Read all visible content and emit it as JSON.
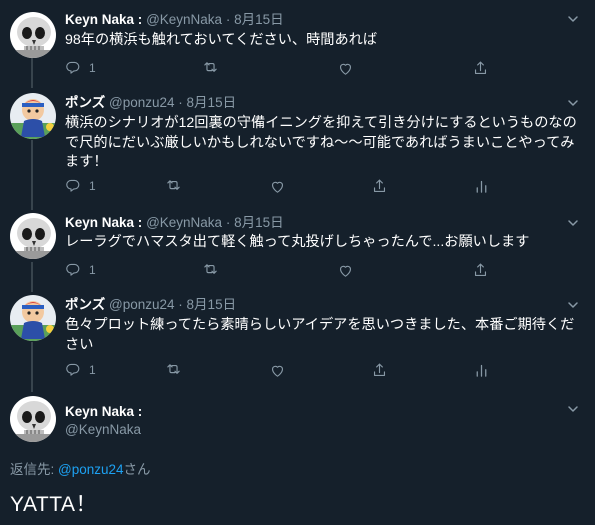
{
  "tweets": [
    {
      "name": "Keyn Naka :",
      "handle": "@KeynNaka",
      "date": "8月15日",
      "text": "98年の横浜も触れておいてください、時間あれば",
      "reply_count": "1",
      "avatar": "skull"
    },
    {
      "name": "ポンズ",
      "handle": "@ponzu24",
      "date": "8月15日",
      "text": "横浜のシナリオが12回裏の守備イニングを抑えて引き分けにするというものなので尺的にだいぶ厳しいかもしれないですね〜〜可能であればうまいことやってみます！",
      "reply_count": "1",
      "avatar": "character"
    },
    {
      "name": "Keyn Naka :",
      "handle": "@KeynNaka",
      "date": "8月15日",
      "text": "レーラグでハマスタ出て軽く触って丸投げしちゃったんで...お願いします",
      "reply_count": "1",
      "avatar": "skull"
    },
    {
      "name": "ポンズ",
      "handle": "@ponzu24",
      "date": "8月15日",
      "text": "色々プロット練ってたら素晴らしいアイデアを思いつきました、本番ご期待ください",
      "reply_count": "1",
      "avatar": "character"
    }
  ],
  "focused": {
    "name": "Keyn Naka :",
    "handle": "@KeynNaka",
    "reply_to_prefix": "返信先: ",
    "reply_to_handle": "@ponzu24",
    "reply_to_suffix": "さん",
    "text": "YATTA！"
  },
  "icons": [
    "reply-icon",
    "retweet-icon",
    "like-icon",
    "share-icon",
    "analytics-icon",
    "chevron-down-icon"
  ],
  "colors": {
    "background": "#15202b",
    "muted": "#8899a6",
    "link": "#1da1f2",
    "divider": "#38444d"
  }
}
